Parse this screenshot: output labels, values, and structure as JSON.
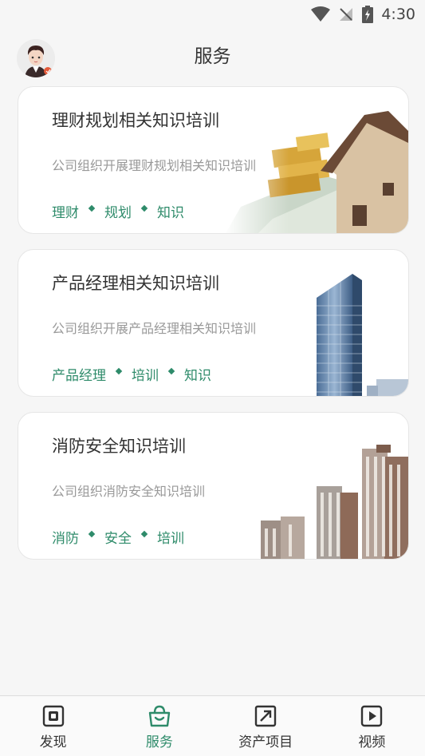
{
  "status_bar": {
    "time": "4:30"
  },
  "header": {
    "title": "服务"
  },
  "cards": [
    {
      "title": "理财规划相关知识培训",
      "description": "公司组织开展理财规划相关知识培训",
      "tags": [
        "理财",
        "规划",
        "知识"
      ]
    },
    {
      "title": "产品经理相关知识培训",
      "description": "公司组织开展产品经理相关知识培训",
      "tags": [
        "产品经理",
        "培训",
        "知识"
      ]
    },
    {
      "title": "消防安全知识培训",
      "description": "公司组织消防安全知识培训",
      "tags": [
        "消防",
        "安全",
        "培训"
      ]
    }
  ],
  "tab_bar": {
    "tabs": [
      {
        "label": "发现",
        "icon": "discover-icon"
      },
      {
        "label": "服务",
        "icon": "service-bag-icon",
        "active": true
      },
      {
        "label": "资产项目",
        "icon": "asset-project-icon"
      },
      {
        "label": "视频",
        "icon": "video-play-icon"
      }
    ]
  },
  "colors": {
    "accent": "#2e8b6a",
    "background": "#f6f6f6",
    "text": "#333333",
    "muted": "#999999"
  }
}
